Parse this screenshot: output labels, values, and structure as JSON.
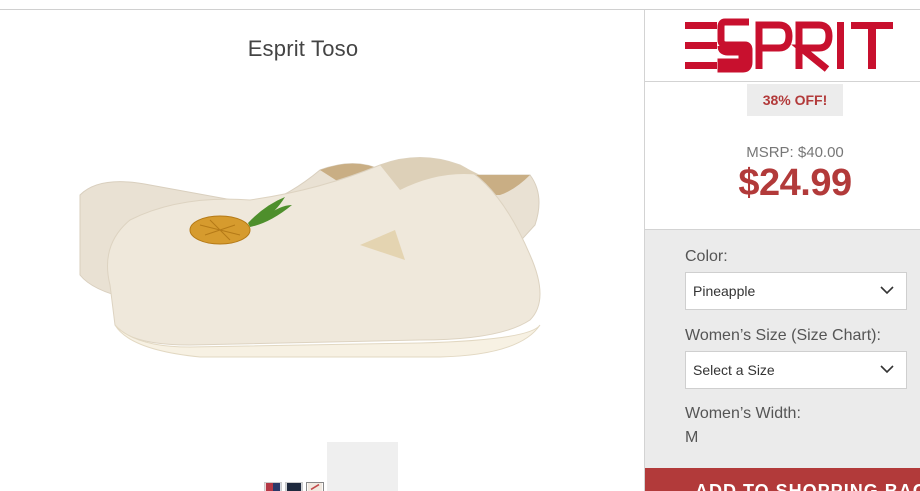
{
  "product": {
    "title": "Esprit Toso",
    "image_alt": "pineapple-slip-on-shoes",
    "swatches": [
      {
        "color": "#b53845",
        "color2": "#2a3a6a"
      },
      {
        "color": "#1f2a3e",
        "color2": "#1f2a3e"
      },
      {
        "color": "#f1e9e0",
        "color2": "#c24a4a"
      }
    ]
  },
  "brand": {
    "logo_text": "ESPRIT",
    "color": "#c8102e"
  },
  "pricing": {
    "discount": "38% OFF!",
    "msrp": "MSRP: $40.00",
    "price": "$24.99",
    "accent": "#b23a3a"
  },
  "options": {
    "color_label": "Color:",
    "color_value": "Pineapple",
    "size_label": "Women’s Size (Size Chart):",
    "size_value": "Select a Size",
    "width_label": "Women’s Width:",
    "width_value": "M"
  },
  "cta": {
    "label": "ADD TO SHOPPING BAG"
  }
}
